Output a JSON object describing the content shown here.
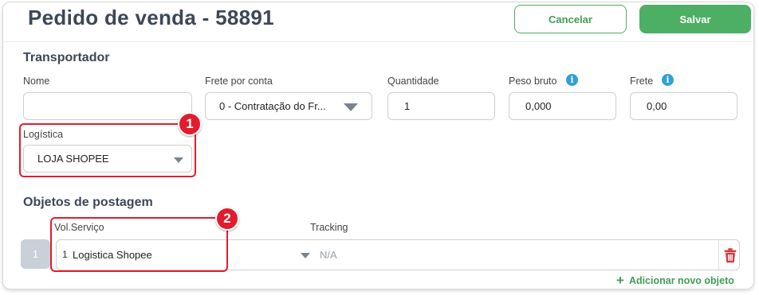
{
  "header": {
    "title": "Pedido de venda - 58891",
    "cancel_label": "Cancelar",
    "save_label": "Salvar"
  },
  "transportador": {
    "section_title": "Transportador",
    "nome": {
      "label": "Nome",
      "value": ""
    },
    "frete_por_conta": {
      "label": "Frete por conta",
      "value": "0 - Contratação do Fr..."
    },
    "quantidade": {
      "label": "Quantidade",
      "value": "1"
    },
    "peso_bruto": {
      "label": "Peso bruto",
      "value": "0,000"
    },
    "frete": {
      "label": "Frete",
      "value": "0,00"
    },
    "logistica": {
      "label": "Logística",
      "value": "LOJA SHOPEE"
    }
  },
  "objetos": {
    "section_title": "Objetos de postagem",
    "col_vol_servico": "Vol.Serviço",
    "col_tracking": "Tracking",
    "rows": [
      {
        "number": "1",
        "vol": "1",
        "servico": "Logistica Shopee",
        "tracking_placeholder": "N/A"
      }
    ],
    "add_label": "Adicionar novo objeto"
  },
  "annotations": [
    "1",
    "2"
  ],
  "colors": {
    "accent_green": "#4caf63",
    "highlight_red": "#e21c2e",
    "info_blue": "#2ea0db",
    "trash_red": "#d9393b"
  },
  "icons": {
    "info": "info-icon",
    "dropdown": "chevron-down-icon",
    "trash": "trash-icon",
    "plus": "plus-icon"
  }
}
